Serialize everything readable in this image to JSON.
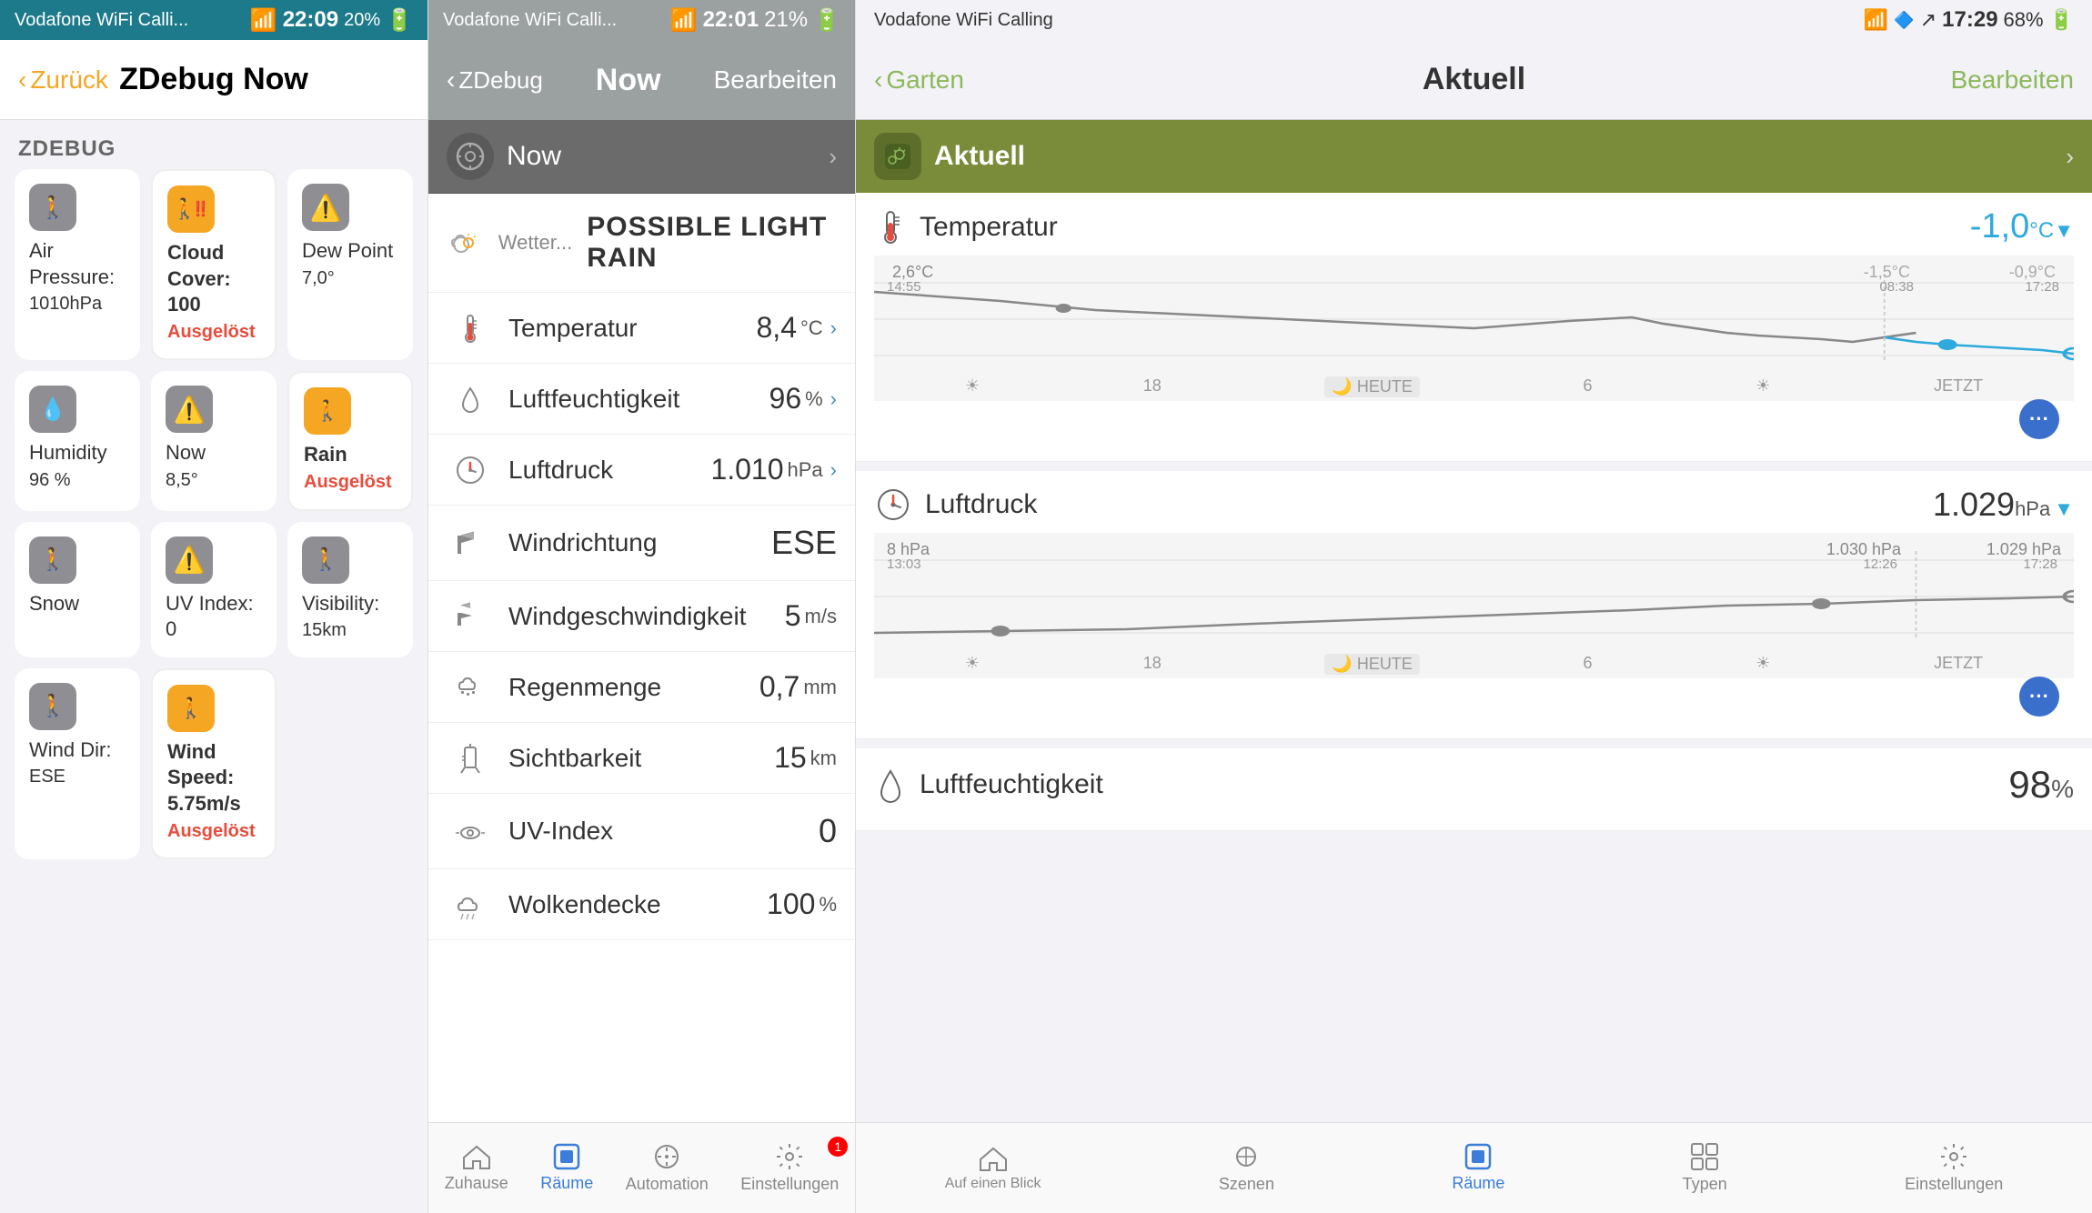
{
  "panel1": {
    "statusBar": {
      "carrier": "Vodafone WiFi Calli...",
      "wifi": "wifi",
      "time": "22:09",
      "battery": "20%"
    },
    "navBar": {
      "backLabel": "Zurück",
      "title": "ZDebug Now"
    },
    "sectionHeader": "ZDEBUG",
    "items": [
      {
        "id": "air-pressure",
        "icon": "🚶",
        "label": "Air Pressure:",
        "value": "1010hPa",
        "triggered": false,
        "orange": false
      },
      {
        "id": "cloud-cover",
        "icon": "⚠️",
        "label": "Cloud Cover: 100",
        "value": "",
        "triggered": true,
        "orange": true,
        "triggeredText": "Ausgelöst"
      },
      {
        "id": "dew-point",
        "icon": "⚠️",
        "label": "Dew Point",
        "value": "7,0°",
        "triggered": false,
        "orange": false
      },
      {
        "id": "humidity",
        "icon": "💧",
        "label": "Humidity",
        "value": "96 %",
        "triggered": false,
        "orange": false
      },
      {
        "id": "now",
        "icon": "⚠️",
        "label": "Now",
        "value": "8,5°",
        "triggered": false,
        "orange": false
      },
      {
        "id": "rain",
        "icon": "🚶",
        "label": "Rain",
        "value": "",
        "triggered": true,
        "orange": true,
        "triggeredText": "Ausgelöst"
      },
      {
        "id": "snow",
        "icon": "🚶",
        "label": "Snow",
        "value": "",
        "triggered": false,
        "orange": false
      },
      {
        "id": "uv-index",
        "icon": "⚠️",
        "label": "UV Index: 0",
        "value": "",
        "triggered": false,
        "orange": false
      },
      {
        "id": "visibility",
        "icon": "🚶",
        "label": "Visibility:",
        "value": "15km",
        "triggered": false,
        "orange": false
      },
      {
        "id": "wind-dir",
        "icon": "🚶",
        "label": "Wind Dir:",
        "value": "ESE",
        "triggered": false,
        "orange": false
      },
      {
        "id": "wind-speed",
        "icon": "🚶",
        "label": "Wind Speed: 5.75m/s",
        "value": "",
        "triggered": true,
        "orange": true,
        "triggeredText": "Ausgelöst"
      },
      {
        "id": "empty",
        "icon": "",
        "label": "",
        "value": "",
        "triggered": false,
        "orange": false
      }
    ]
  },
  "panel2": {
    "statusBar": {
      "carrier": "Vodafone WiFi Calli...",
      "wifi": "wifi",
      "time": "22:01",
      "battery": "21%"
    },
    "navBar": {
      "backLabel": "ZDebug",
      "title": "Now",
      "rightLabel": "Bearbeiten"
    },
    "sceneHeader": {
      "title": "Now",
      "icon": "⚙️"
    },
    "weatherRows": [
      {
        "id": "wetter",
        "icon": "☁️",
        "label": "Wetter...",
        "value": "POSSIBLE LIGHT RAIN",
        "unit": "",
        "hasArrow": false,
        "big": true
      },
      {
        "id": "temperatur",
        "icon": "🌡️",
        "label": "Temperatur",
        "value": "8,4",
        "unit": "°C",
        "hasArrow": true
      },
      {
        "id": "luftfeuchtigkeit",
        "icon": "💧",
        "label": "Luftfeuchtigkeit",
        "value": "96",
        "unit": "%",
        "hasArrow": true
      },
      {
        "id": "luftdruck",
        "icon": "⏱️",
        "label": "Luftdruck",
        "value": "1.010",
        "unit": "hPa",
        "hasArrow": true
      },
      {
        "id": "windrichtung",
        "icon": "🚩",
        "label": "Windrichtung",
        "value": "ESE",
        "unit": "",
        "hasArrow": false
      },
      {
        "id": "windgeschwindigkeit",
        "icon": "🚩",
        "label": "Windgeschwindigkeit",
        "value": "5",
        "unit": "m/s",
        "hasArrow": false
      },
      {
        "id": "regenmenge",
        "icon": "🌧️",
        "label": "Regenmenge",
        "value": "0,7",
        "unit": "mm",
        "hasArrow": false
      },
      {
        "id": "sichtbarkeit",
        "icon": "🏳️",
        "label": "Sichtbarkeit",
        "value": "15",
        "unit": "km",
        "hasArrow": false
      },
      {
        "id": "uv-index",
        "icon": "👓",
        "label": "UV-Index",
        "value": "0",
        "unit": "",
        "hasArrow": false
      },
      {
        "id": "wolkendecke",
        "icon": "☁️",
        "label": "Wolkendecke",
        "value": "100",
        "unit": "%",
        "hasArrow": false
      }
    ],
    "tabBar": {
      "items": [
        {
          "id": "zuhause",
          "label": "Zuhause",
          "icon": "🏠",
          "active": false
        },
        {
          "id": "raume",
          "label": "Räume",
          "icon": "📱",
          "active": true,
          "badge": null
        },
        {
          "id": "automation",
          "label": "Automation",
          "icon": "⏰",
          "active": false
        },
        {
          "id": "einstellungen",
          "label": "Einstellungen",
          "icon": "⚙️",
          "active": false,
          "badge": 1
        }
      ]
    }
  },
  "panel3": {
    "statusBar": {
      "carrier": "Vodafone WiFi Calling",
      "wifi": "wifi",
      "time": "17:29",
      "battery": "68%",
      "bluetooth": "bt"
    },
    "navBar": {
      "backLabel": "Garten",
      "title": "Aktuell",
      "rightLabel": "Bearbeiten"
    },
    "aktuellHeader": {
      "title": "Aktuell",
      "icon": "🌿"
    },
    "temperatur": {
      "title": "Temperatur",
      "value": "-1,0",
      "unit": "°C",
      "hasArrow": true,
      "chart": {
        "labels": [
          "2,6°C 14:55",
          "-1,5°C 08:38",
          "-0,9°C 17:28"
        ],
        "xLabels": [
          "☀️",
          "18",
          "🌙 HEUTE",
          "6",
          "☀️",
          "JETZT"
        ]
      }
    },
    "luftdruck": {
      "title": "Luftdruck",
      "value": "1.029",
      "unit": "hPa",
      "hasArrow": true,
      "chart": {
        "labels": [
          "8 hPa 13:03",
          "1.030 hPa 12:26",
          "1.029 hPa 17:28"
        ],
        "xLabels": [
          "☀️",
          "18",
          "🌙 HEUTE",
          "6",
          "☀️",
          "JETZT"
        ]
      }
    },
    "luftfeuchtigkeit": {
      "title": "Luftfeuchtigkeit",
      "value": "98",
      "unit": "%",
      "hasArrow": false
    },
    "tabBar": {
      "items": [
        {
          "id": "auf-einen-blick",
          "label": "Auf einen Blick",
          "icon": "🏠",
          "active": false
        },
        {
          "id": "szenen",
          "label": "Szenen",
          "icon": "⭐",
          "active": false
        },
        {
          "id": "raume",
          "label": "Räume",
          "icon": "📱",
          "active": true
        },
        {
          "id": "typen",
          "label": "Typen",
          "icon": "🗂️",
          "active": false
        },
        {
          "id": "einstellungen",
          "label": "Einstellungen",
          "icon": "⚙️",
          "active": false
        }
      ]
    }
  }
}
